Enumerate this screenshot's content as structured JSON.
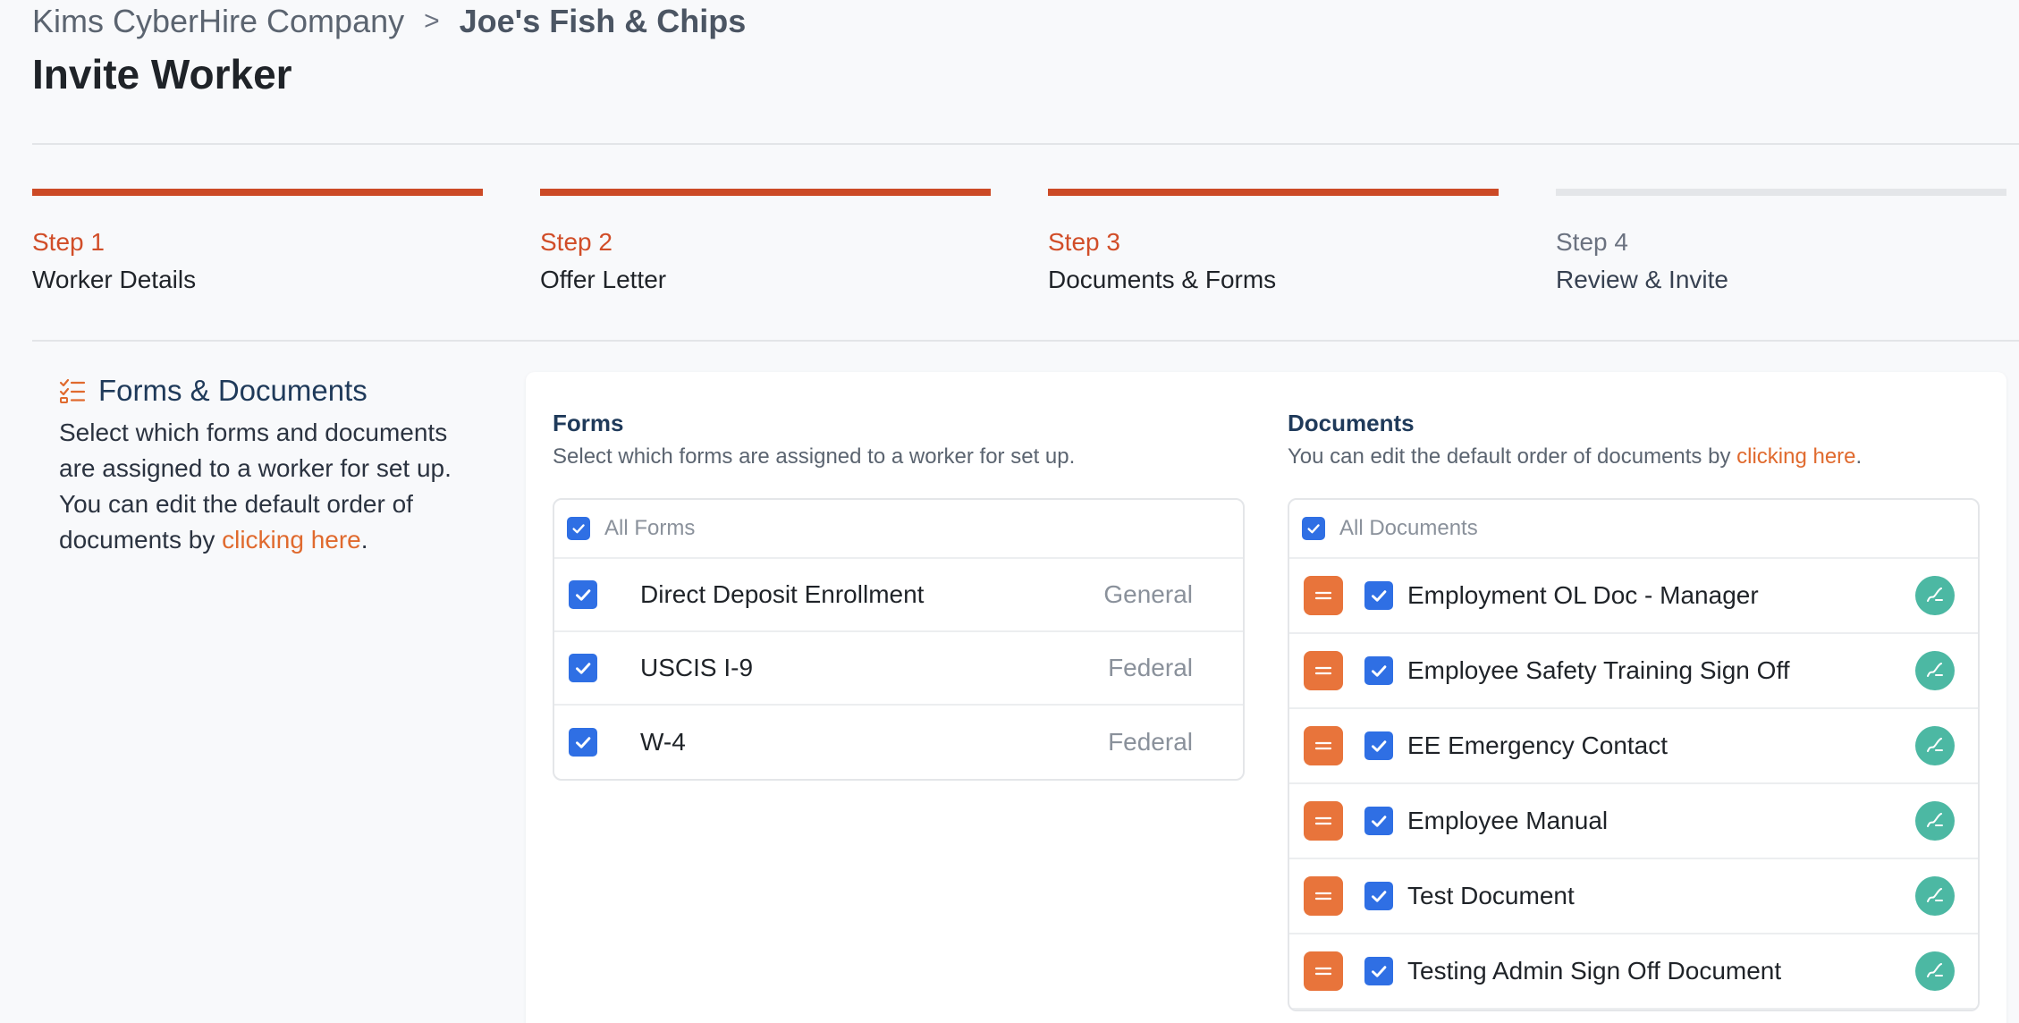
{
  "breadcrumb": {
    "company": "Kims CyberHire Company",
    "separator": ">",
    "current": "Joe's Fish & Chips"
  },
  "page_title": "Invite Worker",
  "steps": [
    {
      "number": "Step 1",
      "name": "Worker Details",
      "state": "complete"
    },
    {
      "number": "Step 2",
      "name": "Offer Letter",
      "state": "complete"
    },
    {
      "number": "Step 3",
      "name": "Documents & Forms",
      "state": "current"
    },
    {
      "number": "Step 4",
      "name": "Review & Invite",
      "state": "upcoming"
    }
  ],
  "aside": {
    "icon": "checklist-icon",
    "title": "Forms & Documents",
    "text_before": "Select which forms and documents are assigned to a worker for set up. You can edit the default order of documents by ",
    "link": "clicking here",
    "text_after": "."
  },
  "forms": {
    "title": "Forms",
    "description": "Select which forms are assigned to a worker for set up.",
    "all_label": "All Forms",
    "all_checked": true,
    "items": [
      {
        "name": "Direct Deposit Enrollment",
        "category": "General",
        "checked": true
      },
      {
        "name": "USCIS I-9",
        "category": "Federal",
        "checked": true
      },
      {
        "name": "W-4",
        "category": "Federal",
        "checked": true
      }
    ]
  },
  "documents": {
    "title": "Documents",
    "description_before": "You can edit the default order of documents by ",
    "description_link": "clicking here",
    "description_after": ".",
    "all_label": "All Documents",
    "all_checked": true,
    "items": [
      {
        "name": "Employment OL Doc - Manager",
        "checked": true,
        "icon": "signature-icon"
      },
      {
        "name": "Employee Safety Training Sign Off",
        "checked": true,
        "icon": "signature-icon"
      },
      {
        "name": "EE Emergency Contact",
        "checked": true,
        "icon": "signature-icon"
      },
      {
        "name": "Employee Manual",
        "checked": true,
        "icon": "signature-icon"
      },
      {
        "name": "Test Document",
        "checked": true,
        "icon": "signature-icon"
      },
      {
        "name": "Testing Admin Sign Off Document",
        "checked": true,
        "icon": "signature-icon"
      }
    ]
  },
  "colors": {
    "accent": "#cc4a26",
    "link": "#e06a2e",
    "checkbox": "#2f6fe4",
    "drag_handle": "#e8743b",
    "signature": "#4cb8a3",
    "inactive_step": "#e4e6e9"
  }
}
